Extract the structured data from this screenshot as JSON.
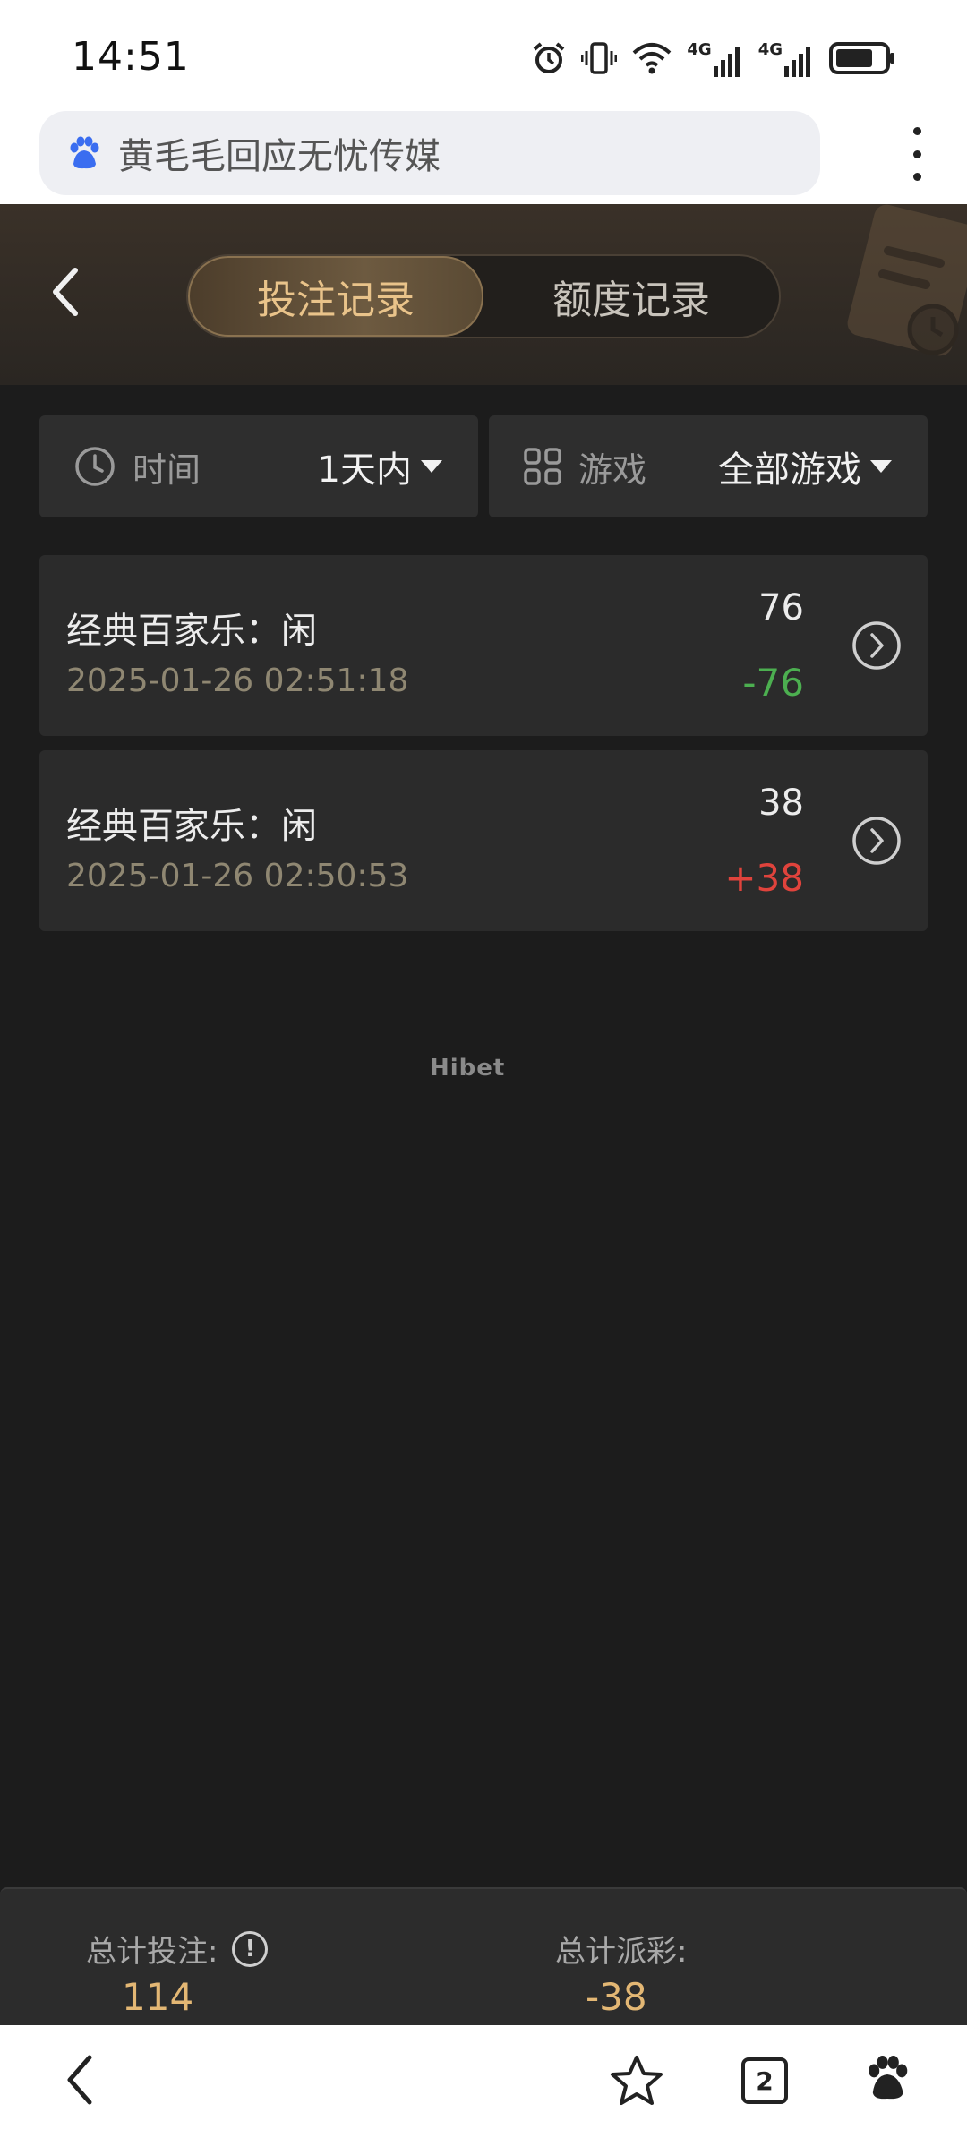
{
  "status_bar": {
    "time": "14:51",
    "network_1": "4G",
    "network_2": "4G"
  },
  "browser": {
    "address_text": "黄毛毛回应无忧传媒",
    "open_tabs_count": "2"
  },
  "header": {
    "tabs": [
      {
        "label": "投注记录",
        "active": true
      },
      {
        "label": "额度记录",
        "active": false
      }
    ]
  },
  "filters": {
    "time": {
      "label": "时间",
      "value": "1天内"
    },
    "game": {
      "label": "游戏",
      "value": "全部游戏"
    }
  },
  "records": [
    {
      "title": "经典百家乐：闲",
      "time": "2025-01-26 02:51:18",
      "amount": "76",
      "payout": "-76"
    },
    {
      "title": "经典百家乐：闲",
      "time": "2025-01-26 02:50:53",
      "amount": "38",
      "payout": "+38"
    }
  ],
  "watermark": "Hibet",
  "summary": {
    "total_bet_label": "总计投注:",
    "total_bet_value": "114",
    "total_payout_label": "总计派彩:",
    "total_payout_value": "-38"
  },
  "colors": {
    "accent_gold": "#e3b774",
    "loss_green": "#4caf50",
    "win_red": "#e0433c",
    "background": "#1c1c1c"
  }
}
